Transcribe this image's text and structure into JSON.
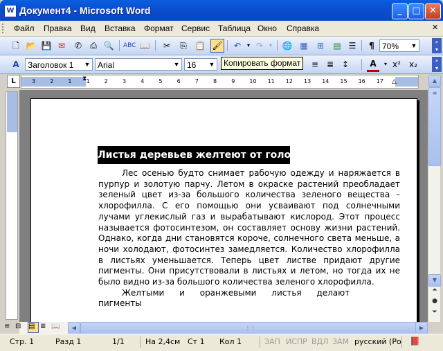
{
  "window": {
    "title": "Документ4 - Microsoft Word",
    "app_icon": "W"
  },
  "menu": [
    "Файл",
    "Правка",
    "Вид",
    "Вставка",
    "Формат",
    "Сервис",
    "Таблица",
    "Окно",
    "Справка"
  ],
  "toolbar": {
    "zoom": "70%",
    "style": "Заголовок 1",
    "font": "Arial",
    "size": "16",
    "tooltip": "Копировать формат"
  },
  "ruler": {
    "marks": [
      "3",
      "2",
      "1",
      "1",
      "2",
      "3",
      "4",
      "5",
      "6",
      "7",
      "8",
      "9",
      "10",
      "11",
      "12",
      "13",
      "14",
      "15",
      "16",
      "17"
    ]
  },
  "document": {
    "heading": "Листья деревьев желтеют от голода",
    "paragraphs": [
      "Лес осенью будто снимает рабочую одежду и наряжается в пурпур и золотую парчу. Летом в окраске растений преобладает зеленый цвет из-за большого количества зеленого вещества – хлорофилла. С его помощью они усваивают под солнечными лучами углекислый газ и вырабатывают кислород. Этот процесс называется фотосинтезом, он составляет основу жизни растений. Однако, когда дни становятся короче, солнечного света меньше, а ночи холодают, фотосинтез замедляется. Количество хлорофилла в листьях уменьшается. Теперь цвет листве придают другие пигменты. Они присутствовали в листьях и летом, но тогда их не было видно из-за большого количества зеленого хлорофилла.",
      "Желтыми и оранжевыми листья делают пигменты"
    ]
  },
  "status": {
    "page": "Стр.  1",
    "section": "Разд  1",
    "pages": "1/1",
    "at": "На 2,4см",
    "line": "Ст  1",
    "col": "Кол  1",
    "rec": "ЗАП",
    "trk": "ИСПР",
    "ext": "ВДЛ",
    "ovr": "ЗАМ",
    "lang": "русский (Ро"
  }
}
